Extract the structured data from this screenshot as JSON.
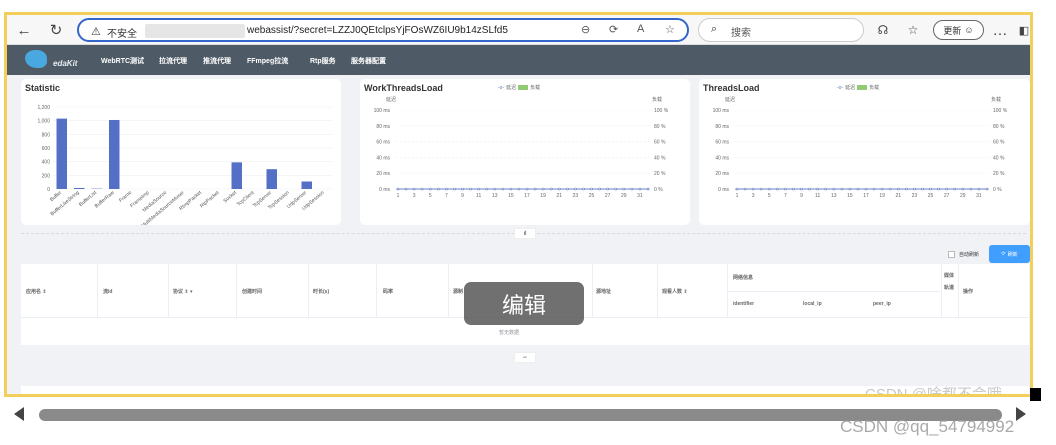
{
  "browser": {
    "insecure_label": "不安全",
    "url": "webassist/?secret=LZZJ0QEtclpsYjFOsWZ6IU9b14zSLfd5",
    "search_placeholder": "搜索",
    "update_label": "更新"
  },
  "app": {
    "logo_text": "edaKit",
    "nav": [
      "WebRTC测试",
      "拉流代理",
      "推流代理",
      "FFmpeg拉流",
      "Rtp服务",
      "服务器配置"
    ]
  },
  "statistic": {
    "title": "Statistic"
  },
  "work_threads": {
    "title": "WorkThreadsLoad",
    "legend": [
      "延迟",
      "负载"
    ],
    "left_axis_title": "延迟",
    "right_axis_title": "负载"
  },
  "threads": {
    "title": "ThreadsLoad",
    "legend": [
      "延迟",
      "负载"
    ],
    "left_axis_title": "延迟",
    "right_axis_title": "负载"
  },
  "chart_data": [
    {
      "type": "bar",
      "title": "Statistic",
      "categories": [
        "Buffer",
        "BufferLikeString",
        "BufferList",
        "BufferRaw",
        "Frame",
        "FrameImp",
        "MediaSource",
        "MultiMediaSourceMuxer",
        "RtmpPacket",
        "RtpPacket",
        "Socket",
        "TcpClient",
        "TcpServer",
        "TcpSession",
        "UdpServer",
        "UdpSession"
      ],
      "values": [
        1030,
        15,
        5,
        1010,
        0,
        0,
        0,
        0,
        0,
        0,
        390,
        0,
        290,
        0,
        110,
        0
      ],
      "ylim": [
        0,
        1200
      ],
      "yticks": [
        "0",
        "200",
        "400",
        "600",
        "800",
        "1,000",
        "1,200"
      ],
      "color": "#5470c6"
    },
    {
      "type": "line",
      "title": "WorkThreadsLoad",
      "x": [
        1,
        2,
        3,
        4,
        5,
        6,
        7,
        8,
        9,
        10,
        11,
        12,
        13,
        14,
        15,
        16,
        17,
        18,
        19,
        20,
        21,
        22,
        23,
        24,
        25,
        26,
        27,
        28,
        29,
        30,
        31,
        32
      ],
      "xticks": [
        "1",
        "3",
        "5",
        "7",
        "9",
        "11",
        "13",
        "15",
        "17",
        "19",
        "21",
        "23",
        "25",
        "27",
        "29",
        "31"
      ],
      "series": [
        {
          "name": "延迟",
          "values": [
            0,
            0,
            0,
            0,
            0,
            0,
            0,
            0,
            0,
            0,
            0,
            0,
            0,
            0,
            0,
            0,
            0,
            0,
            0,
            0,
            0,
            0,
            0,
            0,
            0,
            0,
            0,
            0,
            0,
            0,
            0,
            0
          ],
          "color": "#5470c6"
        },
        {
          "name": "负载",
          "values": [
            0,
            0,
            0,
            0,
            0,
            0,
            0,
            0,
            0,
            0,
            0,
            0,
            0,
            0,
            0,
            0,
            0,
            0,
            0,
            0,
            0,
            0,
            0,
            0,
            0,
            0,
            0,
            0,
            0,
            0,
            0,
            0
          ],
          "color": "#91cc75"
        }
      ],
      "yleft_ticks": [
        "0 ms",
        "20 ms",
        "40 ms",
        "60 ms",
        "80 ms",
        "100 ms"
      ],
      "yright_ticks": [
        "0 %",
        "20 %",
        "40 %",
        "60 %",
        "80 %",
        "100 %"
      ],
      "legend_position": "top-center"
    },
    {
      "type": "line",
      "title": "ThreadsLoad",
      "x": [
        1,
        2,
        3,
        4,
        5,
        6,
        7,
        8,
        9,
        10,
        11,
        12,
        13,
        14,
        15,
        16,
        17,
        18,
        19,
        20,
        21,
        22,
        23,
        24,
        25,
        26,
        27,
        28,
        29,
        30,
        31,
        32
      ],
      "xticks": [
        "1",
        "3",
        "5",
        "7",
        "9",
        "11",
        "13",
        "15",
        "17",
        "19",
        "21",
        "23",
        "25",
        "27",
        "29",
        "31"
      ],
      "series": [
        {
          "name": "延迟",
          "values": [
            0,
            0,
            0,
            0,
            0,
            0,
            0,
            0,
            0,
            0,
            0,
            0,
            0,
            0,
            0,
            0,
            0,
            0,
            0,
            0,
            0,
            0,
            0,
            0,
            0,
            0,
            0,
            0,
            0,
            0,
            0,
            0
          ],
          "color": "#5470c6"
        },
        {
          "name": "负载",
          "values": [
            0,
            0,
            0,
            0,
            0,
            0,
            0,
            0,
            0,
            0,
            0,
            0,
            0,
            0,
            0,
            0,
            0,
            0,
            0,
            0,
            0,
            0,
            0,
            0,
            0,
            0,
            0,
            0,
            0,
            0,
            0,
            0
          ],
          "color": "#91cc75"
        }
      ],
      "yleft_ticks": [
        "0 ms",
        "20 ms",
        "40 ms",
        "60 ms",
        "80 ms",
        "100 ms"
      ],
      "yright_ticks": [
        "0 %",
        "20 %",
        "40 %",
        "60 %",
        "80 %",
        "100 %"
      ],
      "legend_position": "top-center"
    }
  ],
  "controls": {
    "auto_refresh_label": "自动刷新",
    "refresh_label": "刷新"
  },
  "table": {
    "headers": [
      "应用名",
      "流id",
      "协议",
      "创建时间",
      "时长(s)",
      "码率",
      "源制",
      "源地址",
      "观看人数",
      "网络信息",
      "媒体轨道",
      "操作"
    ],
    "network_sub": [
      "identifier",
      "local_ip",
      "peer_ip"
    ],
    "empty_text": "暂无数据"
  },
  "overlay": {
    "edit_label": "编辑"
  },
  "watermarks": {
    "inner": "CSDN @啥都不会哦",
    "outer": "CSDN @qq_54794992"
  },
  "colors": {
    "accent": "#409eff",
    "nav_bg": "#4e5a66",
    "frame_border": "#f2cf5b"
  }
}
